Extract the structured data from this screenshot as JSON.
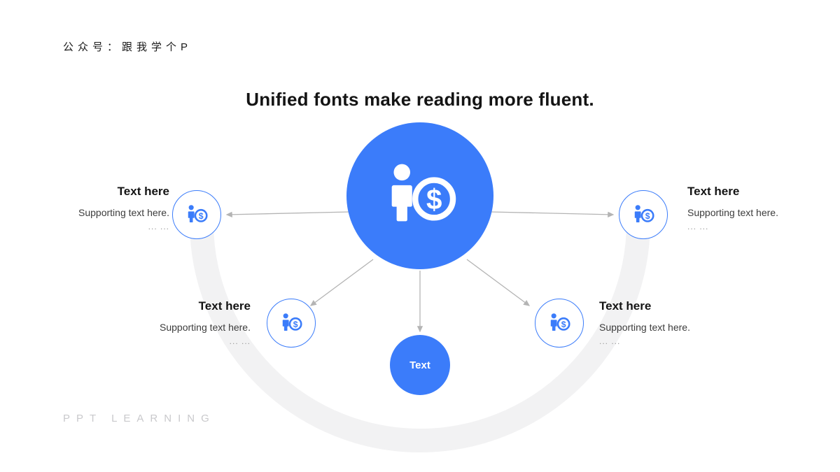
{
  "watermark": {
    "top": "公众号：跟我学个P",
    "bottom": "PPT LEARNING"
  },
  "slide": {
    "title": "Unified fonts make reading more fluent."
  },
  "colors": {
    "accent_blue": "#3b7cfa",
    "arc_gray": "#f2f2f3",
    "connector_gray": "#b4b4b4",
    "title_black": "#141414",
    "footer_gray": "#c9c9cc"
  },
  "center": {
    "icon": "person-with-dollar-coin-icon"
  },
  "bottom_node": {
    "label": "Text",
    "shape": "circle"
  },
  "nodes": [
    {
      "id": "node-1",
      "position": "left",
      "align": "right",
      "icon": "person-with-dollar-coin-icon",
      "heading": "Text here",
      "supporting": "Supporting text here.",
      "dots": "... ..."
    },
    {
      "id": "node-2",
      "position": "right",
      "align": "left",
      "icon": "person-with-dollar-coin-icon",
      "heading": "Text here",
      "supporting": "Supporting text here.",
      "dots": "... ..."
    },
    {
      "id": "node-3",
      "position": "lower-left",
      "align": "right",
      "icon": "person-with-dollar-coin-icon",
      "heading": "Text here",
      "supporting": "Supporting text here.",
      "dots": "... ..."
    },
    {
      "id": "node-4",
      "position": "lower-right",
      "align": "left",
      "icon": "person-with-dollar-coin-icon",
      "heading": "Text here",
      "supporting": "Supporting text here.",
      "dots": "... ..."
    }
  ]
}
